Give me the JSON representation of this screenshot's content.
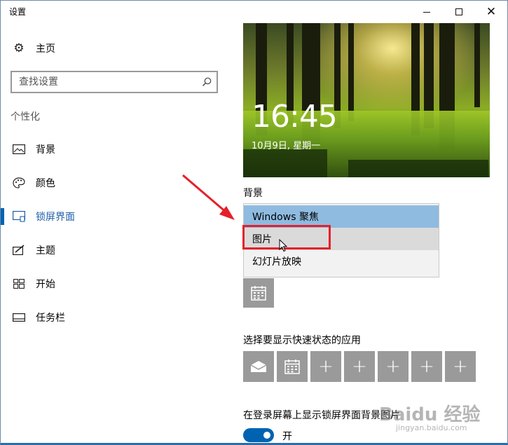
{
  "window": {
    "title": "设置",
    "minimize": "—",
    "maximize": "□",
    "close": "✕"
  },
  "sidebar": {
    "home_label": "主页",
    "search_placeholder": "查找设置",
    "section": "个性化",
    "items": [
      {
        "label": "背景",
        "icon": "picture-icon"
      },
      {
        "label": "颜色",
        "icon": "palette-icon"
      },
      {
        "label": "锁屏界面",
        "icon": "lock-screen-icon",
        "active": true
      },
      {
        "label": "主题",
        "icon": "theme-icon"
      },
      {
        "label": "开始",
        "icon": "start-icon"
      },
      {
        "label": "任务栏",
        "icon": "taskbar-icon"
      }
    ]
  },
  "preview": {
    "time": "16:45",
    "date": "10月9日, 星期一"
  },
  "background": {
    "label": "背景",
    "options": [
      "Windows 聚焦",
      "图片",
      "幻灯片放映"
    ],
    "selected": "Windows 聚焦",
    "hovered": "图片"
  },
  "quick_status": {
    "label": "选择要显示快速状态的应用"
  },
  "show_bg_on_signin": {
    "label": "在登录屏幕上显示锁屏界面背景图片",
    "state": "开",
    "on": true
  },
  "watermark": {
    "brand": "Baidu 经验",
    "url": "jingyan.baidu.com"
  },
  "colors": {
    "accent": "#0063b1",
    "highlight": "#8fbbe0",
    "annotation": "#e5202a"
  }
}
